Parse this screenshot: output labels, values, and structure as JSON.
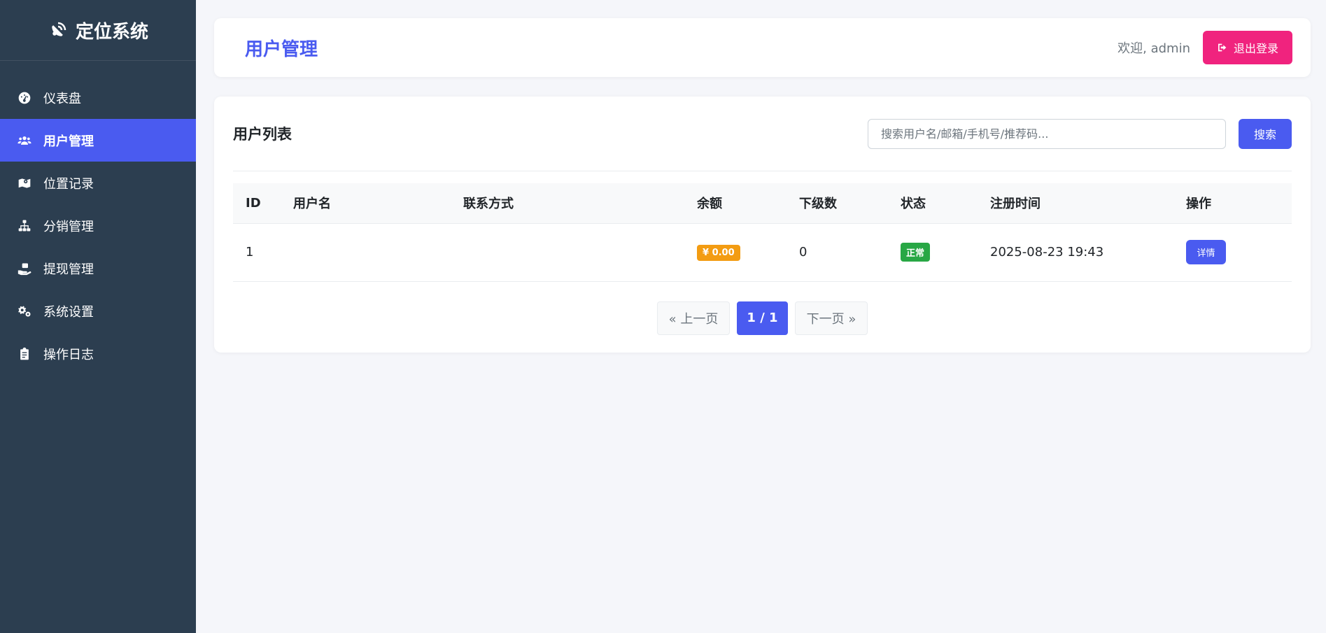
{
  "brand": {
    "title": "定位系统"
  },
  "sidebar": {
    "items": [
      {
        "label": "仪表盘",
        "icon": "dashboard-icon",
        "active": false
      },
      {
        "label": "用户管理",
        "icon": "users-icon",
        "active": true
      },
      {
        "label": "位置记录",
        "icon": "map-icon",
        "active": false
      },
      {
        "label": "分销管理",
        "icon": "sitemap-icon",
        "active": false
      },
      {
        "label": "提现管理",
        "icon": "hand-money-icon",
        "active": false
      },
      {
        "label": "系统设置",
        "icon": "gears-icon",
        "active": false
      },
      {
        "label": "操作日志",
        "icon": "clipboard-icon",
        "active": false
      }
    ]
  },
  "header": {
    "title": "用户管理",
    "welcome": "欢迎, admin",
    "logout_label": "退出登录"
  },
  "list": {
    "title": "用户列表",
    "search_placeholder": "搜索用户名/邮箱/手机号/推荐码...",
    "search_label": "搜索",
    "columns": [
      "ID",
      "用户名",
      "联系方式",
      "余额",
      "下级数",
      "状态",
      "注册时间",
      "操作"
    ],
    "rows": [
      {
        "id": "1",
        "username": "",
        "contact": "",
        "balance": "¥ 0.00",
        "sub_count": "0",
        "status": "正常",
        "registered": "2025-08-23 19:43",
        "action": "详情"
      }
    ]
  },
  "pager": {
    "prev_label": "« 上一页",
    "current_label": "1 / 1",
    "next_label": "下一页 »"
  },
  "colors": {
    "sidebar_bg": "#2c3e50",
    "accent": "#4a5bf0",
    "logout": "#f0237e",
    "balance_badge": "#f39c12",
    "status_ok": "#28a745"
  }
}
